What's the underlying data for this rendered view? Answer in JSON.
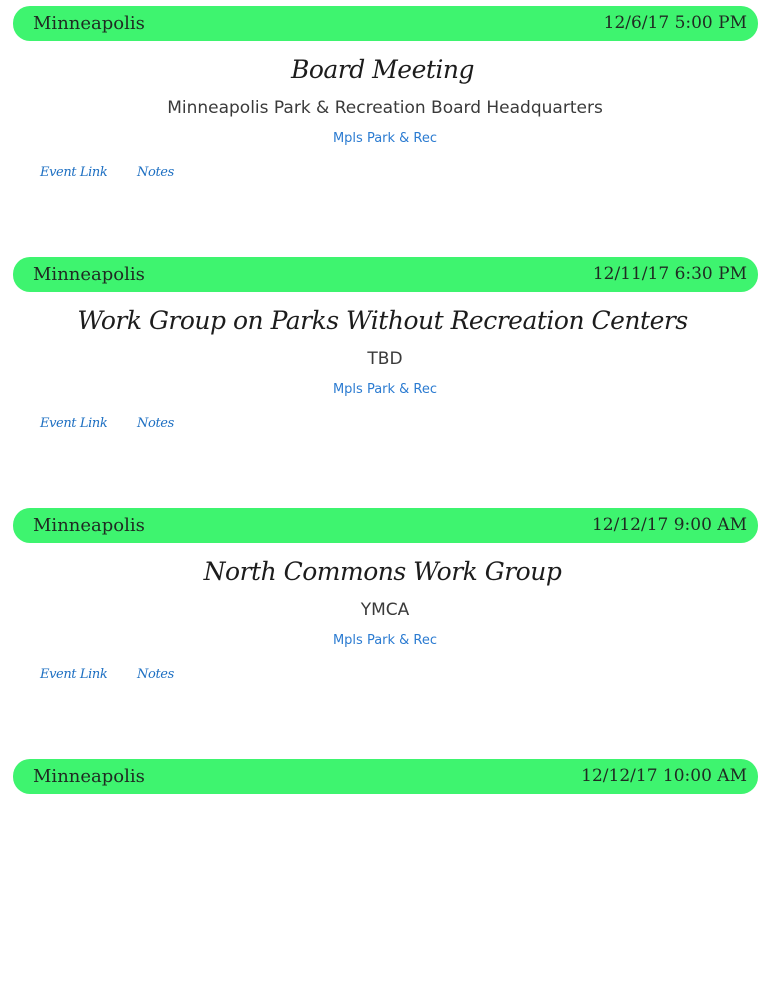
{
  "events": [
    {
      "city": "Minneapolis",
      "datetime": "12/6/17 5:00 PM",
      "title": "Board Meeting",
      "venue": "Minneapolis Park & Recreation Board Headquarters",
      "organizer": "Mpls Park & Rec",
      "event_link_label": "Event Link",
      "notes_label": "Notes"
    },
    {
      "city": "Minneapolis",
      "datetime": "12/11/17 6:30 PM",
      "title": "Work Group on Parks Without Recreation Centers",
      "venue": "TBD",
      "organizer": "Mpls Park & Rec",
      "event_link_label": "Event Link",
      "notes_label": "Notes"
    },
    {
      "city": "Minneapolis",
      "datetime": "12/12/17 9:00 AM",
      "title": "North Commons Work Group",
      "venue": "YMCA",
      "organizer": "Mpls Park & Rec",
      "event_link_label": "Event Link",
      "notes_label": "Notes"
    },
    {
      "city": "Minneapolis",
      "datetime": "12/12/17 10:00 AM"
    }
  ],
  "colors": {
    "header_bar": "#3ef46f",
    "link": "#1d6fc2",
    "organizer": "#2b7bd1"
  }
}
